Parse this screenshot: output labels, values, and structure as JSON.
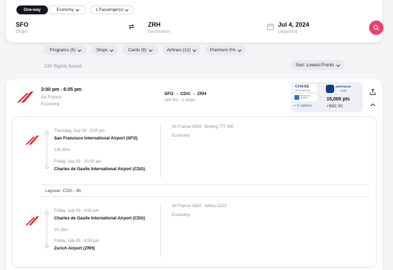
{
  "search": {
    "trip_type": "One-way",
    "cabin": "Economy",
    "passengers": "1 Passenger(s)",
    "origin_code": "SFO",
    "origin_label": "Origin",
    "destination_code": "ZRH",
    "destination_label": "Destination",
    "date": "Jul 4, 2024",
    "date_label": "Departing"
  },
  "filters": [
    "Programs (5)",
    "Stops",
    "Cards (8)",
    "Airlines (12)",
    "Premium 0%"
  ],
  "results": {
    "count": "130 flights found",
    "sort": "Sort: Lowest Points"
  },
  "flight": {
    "times": "3:00 pm - 6:05 pm",
    "airline": "Air France",
    "cabin": "Economy",
    "route": "SFO → CDG → ZRH",
    "duration": "18h 5m · 1 stops",
    "price": {
      "card_brand": "CHASE",
      "card_program": "Ultimate Rewards",
      "amex_program": "Membership Rewards",
      "more_options": "+ 5 options",
      "partner_brand": "AIRFRANCE",
      "partner_sub": "KLM",
      "points": "15,000 pts",
      "cash": "+$82.50"
    },
    "segments": [
      {
        "dep_time": "Thursday, July 04 · 3:00 pm",
        "dep_airport": "San Francisco International Airport (SFO)",
        "duration": "10h 50m",
        "arr_time": "Friday, July 05 · 10:50 am",
        "arr_airport": "Charles de Gaulle International Airport (CDG)",
        "aircraft": "Air France 0083 · Boeing 777-300",
        "cabin": "Economy"
      },
      {
        "dep_time": "Friday, July 05 · 4:50 pm",
        "dep_airport": "Charles de Gaulle International Airport (CDG)",
        "duration": "1h 15m",
        "arr_time": "Friday, July 05 · 6:05 pm",
        "arr_airport": "Zurich Airport (ZRH)",
        "aircraft": "Air France 1814 · Airbus A320",
        "cabin": "Economy"
      }
    ],
    "layover": "Layover: CDG - 6h"
  },
  "colors": {
    "accent": "#ef3f6b",
    "airline_red": "#e8242b",
    "dark": "#15171f"
  }
}
